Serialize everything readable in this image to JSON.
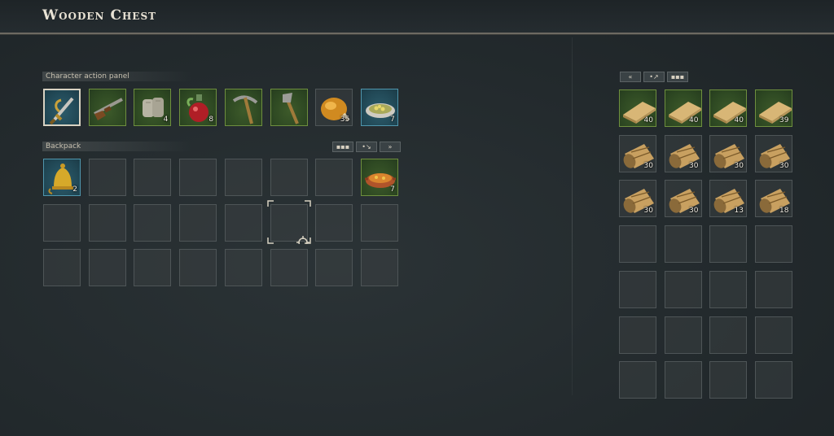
{
  "window": {
    "title": "Wooden Chest"
  },
  "action_panel": {
    "label": "Character action panel",
    "slots": [
      {
        "icon": "sword-icon",
        "count": "",
        "rarity": "blue",
        "selected": true
      },
      {
        "icon": "musket-icon",
        "count": "",
        "rarity": "green"
      },
      {
        "icon": "bandage-icon",
        "count": "4",
        "rarity": "green"
      },
      {
        "icon": "potion-icon",
        "count": "8",
        "rarity": "green"
      },
      {
        "icon": "pickaxe-icon",
        "count": "",
        "rarity": "green"
      },
      {
        "icon": "axe-icon",
        "count": "",
        "rarity": "green"
      },
      {
        "icon": "roast-chicken-icon",
        "count": "35",
        "rarity": "none"
      },
      {
        "icon": "stew-bowl-icon",
        "count": "7",
        "rarity": "blue"
      }
    ]
  },
  "backpack": {
    "label": "Backpack",
    "buttons": [
      "▪▪▪",
      "•↘",
      "»"
    ],
    "slots": [
      {
        "icon": "bell-icon",
        "count": "2",
        "rarity": "blue"
      },
      {
        "icon": "",
        "count": ""
      },
      {
        "icon": "",
        "count": ""
      },
      {
        "icon": "",
        "count": ""
      },
      {
        "icon": "",
        "count": ""
      },
      {
        "icon": "",
        "count": ""
      },
      {
        "icon": "",
        "count": ""
      },
      {
        "icon": "soup-pot-icon",
        "count": "7",
        "rarity": "green"
      }
    ]
  },
  "chest": {
    "buttons": [
      "«",
      "•↗",
      "▪▪▪"
    ],
    "slots": [
      {
        "icon": "plank-icon",
        "count": "40",
        "rarity": "green"
      },
      {
        "icon": "plank-icon",
        "count": "40",
        "rarity": "green"
      },
      {
        "icon": "plank-icon",
        "count": "40",
        "rarity": "green"
      },
      {
        "icon": "plank-icon",
        "count": "39",
        "rarity": "green"
      },
      {
        "icon": "log-icon",
        "count": "30"
      },
      {
        "icon": "log-icon",
        "count": "30"
      },
      {
        "icon": "log-icon",
        "count": "30"
      },
      {
        "icon": "log-icon",
        "count": "30"
      },
      {
        "icon": "log-icon",
        "count": "30"
      },
      {
        "icon": "log-icon",
        "count": "30"
      },
      {
        "icon": "log-icon",
        "count": "13"
      },
      {
        "icon": "log-icon",
        "count": "18"
      }
    ]
  }
}
